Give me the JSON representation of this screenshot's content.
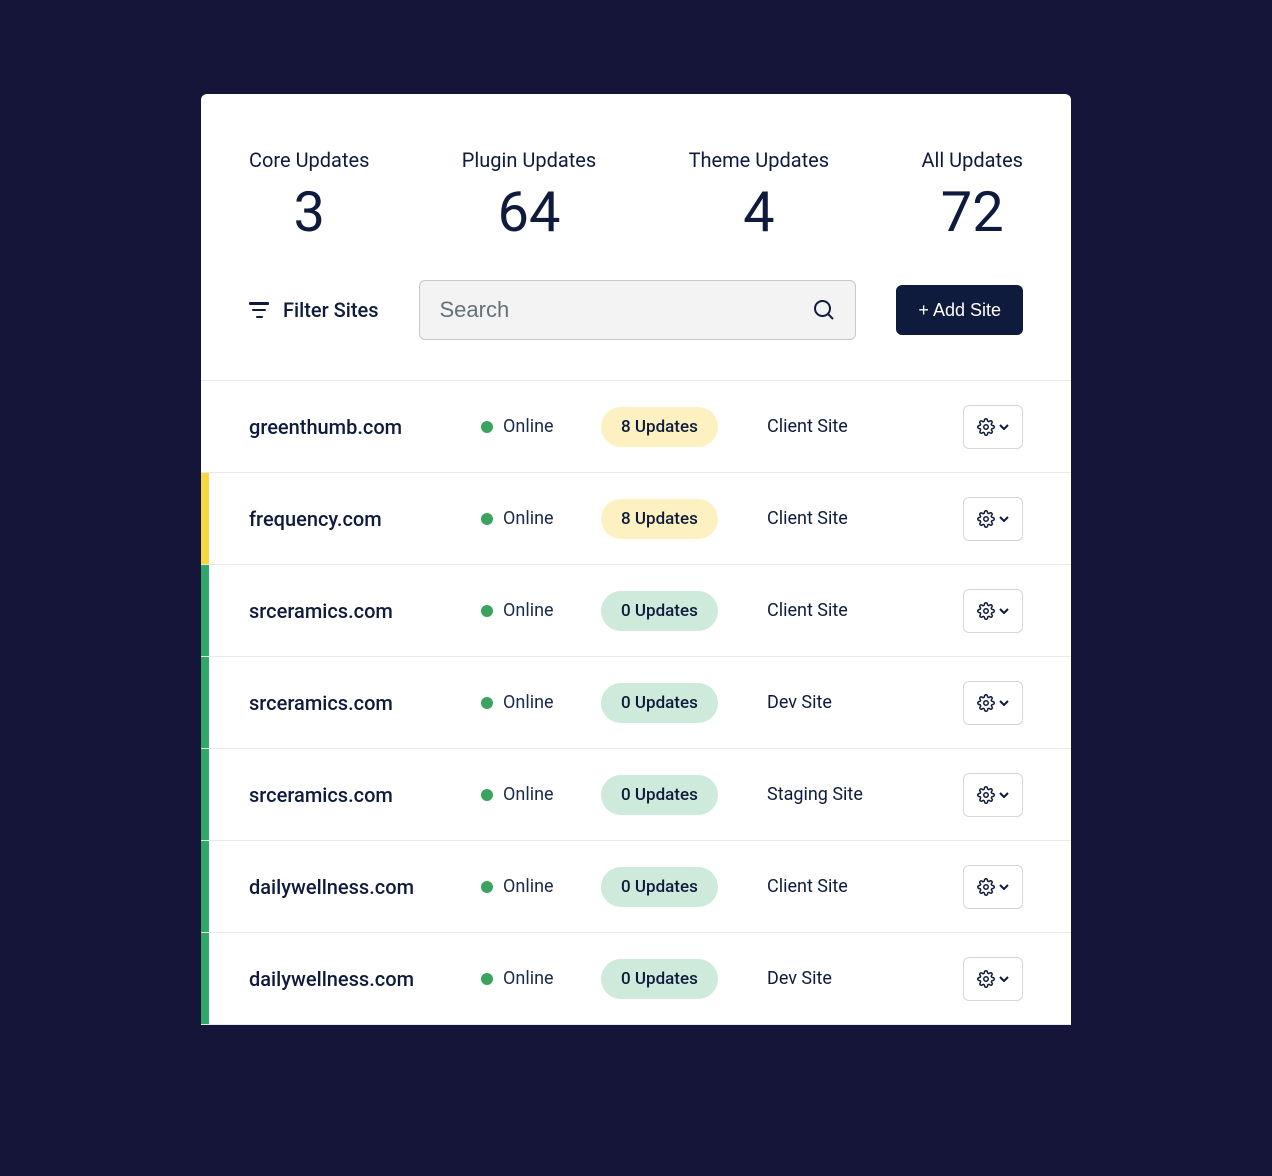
{
  "stats": {
    "core": {
      "label": "Core Updates",
      "value": "3"
    },
    "plugin": {
      "label": "Plugin Updates",
      "value": "64"
    },
    "theme": {
      "label": "Theme Updates",
      "value": "4"
    },
    "all": {
      "label": "All Updates",
      "value": "72"
    }
  },
  "controls": {
    "filter_label": "Filter Sites",
    "search_placeholder": "Search",
    "add_site_label": "+ Add Site"
  },
  "sites": [
    {
      "name": "greenthumb.com",
      "status": "Online",
      "updates": "8 Updates",
      "updates_kind": "warn",
      "type": "Client Site",
      "flag": "none"
    },
    {
      "name": "frequency.com",
      "status": "Online",
      "updates": "8 Updates",
      "updates_kind": "warn",
      "type": "Client Site",
      "flag": "yellow"
    },
    {
      "name": "srceramics.com",
      "status": "Online",
      "updates": "0 Updates",
      "updates_kind": "ok",
      "type": "Client Site",
      "flag": "green"
    },
    {
      "name": "srceramics.com",
      "status": "Online",
      "updates": "0 Updates",
      "updates_kind": "ok",
      "type": "Dev Site",
      "flag": "green"
    },
    {
      "name": "srceramics.com",
      "status": "Online",
      "updates": "0 Updates",
      "updates_kind": "ok",
      "type": "Staging Site",
      "flag": "green"
    },
    {
      "name": "dailywellness.com",
      "status": "Online",
      "updates": "0 Updates",
      "updates_kind": "ok",
      "type": "Client Site",
      "flag": "green"
    },
    {
      "name": "dailywellness.com",
      "status": "Online",
      "updates": "0 Updates",
      "updates_kind": "ok",
      "type": "Dev Site",
      "flag": "green"
    }
  ]
}
